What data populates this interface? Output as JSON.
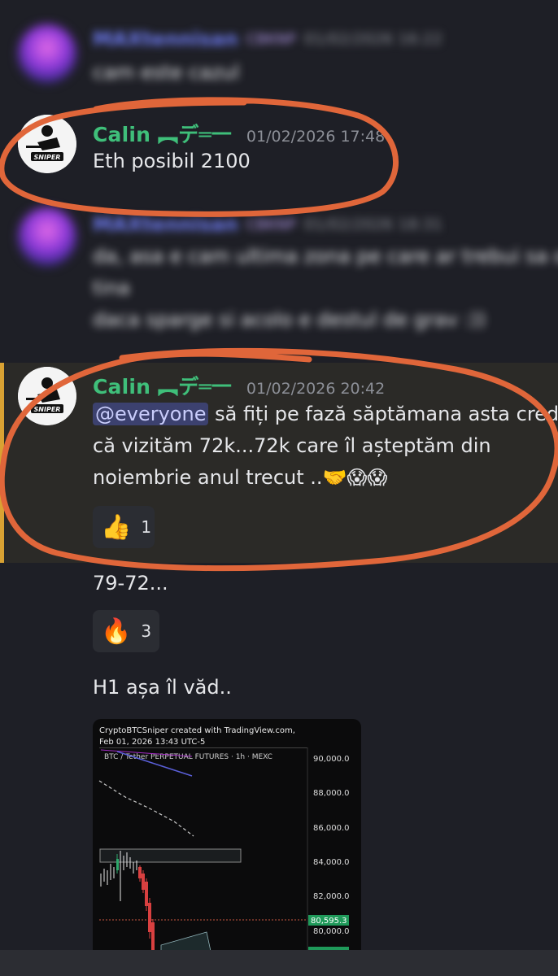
{
  "messages": [
    {
      "username": "MAXtennisan",
      "badge": "CBKNP",
      "timestamp": "01/02/2026 16:22",
      "text": "cam este cazul"
    },
    {
      "username": "Calin ︻デ═一",
      "timestamp": "01/02/2026 17:48",
      "text": "Eth posibil 2100"
    },
    {
      "username": "MAXtennisan",
      "badge": "CBKNP",
      "timestamp": "01/02/2026 18:31",
      "lines": [
        "da, asa e cam ultima zona pe care ar trebui sa o",
        "tina",
        "daca sparge si acolo e destul de grav :))"
      ]
    },
    {
      "username": "Calin ︻デ═一",
      "timestamp": "01/02/2026 20:42",
      "mention": "@everyone",
      "line1_rest": " să fiți pe fază săptămana asta cred",
      "line2": "că vizităm 72k...72k care îl așteptăm din",
      "line3": "noiembrie anul trecut ..🤝😱😱",
      "reaction": {
        "emoji": "👍",
        "count": "1"
      }
    },
    {
      "text": "79-72...",
      "reaction": {
        "emoji": "🔥",
        "count": "3"
      }
    },
    {
      "text": "H1 așa îl văd.."
    }
  ],
  "avatar_logo_text": "SNIPER",
  "chart_image": {
    "header_line1": "CryptoBTCSniper created with TradingView.com,",
    "header_line2": "Feb 01, 2026 13:43 UTC-5",
    "symbol": "BTC / Tether PERPETUAL FUTURES · 1h · MEXC",
    "price_labels": [
      "90,000.0",
      "88,000.0",
      "86,000.0",
      "84,000.0",
      "82,000.0",
      "80,000.0"
    ],
    "current_price": "80,595.3"
  },
  "colors": {
    "background": "#1e1f26",
    "username_green": "#3fbf7a",
    "annotation_orange": "#e0663a",
    "highlight_bar": "#d9a233",
    "mention_bg": "#3c416f"
  }
}
